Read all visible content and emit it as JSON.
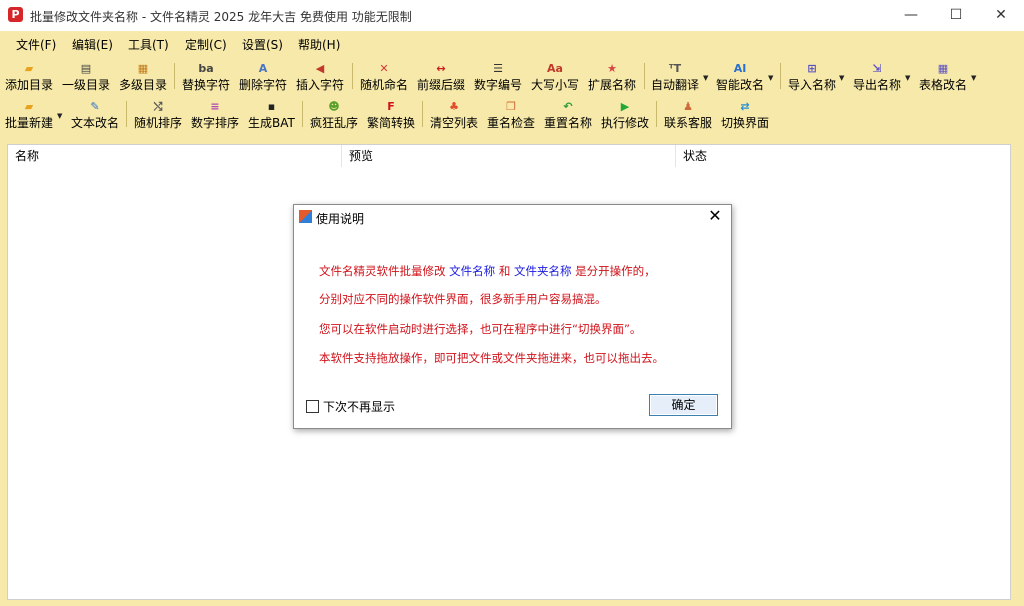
{
  "window": {
    "title": "批量修改文件夹名称 - 文件名精灵 2025 龙年大吉 免费使用 功能无限制",
    "app_icon": "P",
    "minimize_glyph": "—",
    "maximize_glyph": "☐",
    "close_glyph": "✕"
  },
  "menu": [
    "文件(F)",
    "编辑(E)",
    "工具(T)",
    "定制(C)",
    "设置(S)",
    "帮助(H)"
  ],
  "toolbar_row1": [
    {
      "label": "添加目录",
      "icon": "folder-add-icon",
      "glyph": "▰",
      "color": "#e8a21d"
    },
    {
      "label": "一级目录",
      "icon": "single-level-icon",
      "glyph": "▤",
      "color": "#444444"
    },
    {
      "label": "多级目录",
      "icon": "multi-level-icon",
      "glyph": "▦",
      "color": "#c07a1a"
    },
    {
      "label": "替换字符",
      "icon": "replace-text-icon",
      "glyph": "ba",
      "color": "#444444"
    },
    {
      "label": "删除字符",
      "icon": "delete-text-icon",
      "glyph": "A",
      "color": "#4673c6"
    },
    {
      "label": "插入字符",
      "icon": "insert-text-icon",
      "glyph": "◀",
      "color": "#c0392b"
    },
    {
      "label": "随机命名",
      "icon": "random-name-icon",
      "glyph": "✕",
      "color": "#d63b3b"
    },
    {
      "label": "前缀后缀",
      "icon": "prefix-suffix-icon",
      "glyph": "↔",
      "color": "#cc2020"
    },
    {
      "label": "数字编号",
      "icon": "number-list-icon",
      "glyph": "☰",
      "color": "#333333"
    },
    {
      "label": "大写小写",
      "icon": "case-icon",
      "glyph": "Aa",
      "color": "#c0392b"
    },
    {
      "label": "扩展名称",
      "icon": "extension-icon",
      "glyph": "★",
      "color": "#d64545"
    },
    {
      "label": "自动翻译",
      "icon": "translate-icon",
      "glyph": "ᵀT",
      "color": "#555555"
    },
    {
      "label": "智能改名",
      "icon": "ai-icon",
      "glyph": "AI",
      "color": "#2a6fd1"
    },
    {
      "label": "导入名称",
      "icon": "import-icon",
      "glyph": "⊞",
      "color": "#5b4fc4"
    },
    {
      "label": "导出名称",
      "icon": "export-icon",
      "glyph": "⇲",
      "color": "#5b4fc4"
    },
    {
      "label": "表格改名",
      "icon": "table-icon",
      "glyph": "▦",
      "color": "#5b4fc4"
    }
  ],
  "toolbar_row2": [
    {
      "label": "批量新建",
      "icon": "new-folder-icon",
      "glyph": "▰",
      "color": "#e8a21d"
    },
    {
      "label": "文本改名",
      "icon": "text-edit-icon",
      "glyph": "✎",
      "color": "#2a6fd1"
    },
    {
      "label": "随机排序",
      "icon": "shuffle-icon",
      "glyph": "⤭",
      "color": "#555555"
    },
    {
      "label": "数字排序",
      "icon": "sort-number-icon",
      "glyph": "≡",
      "color": "#b04ab0"
    },
    {
      "label": "生成BAT",
      "icon": "bat-icon",
      "glyph": "▪",
      "color": "#222222"
    },
    {
      "label": "疯狂乱序",
      "icon": "crazy-shuffle-icon",
      "glyph": "☻",
      "color": "#5aa02c"
    },
    {
      "label": "繁简转换",
      "icon": "convert-icon",
      "glyph": "F",
      "color": "#d0121a"
    },
    {
      "label": "清空列表",
      "icon": "clear-list-icon",
      "glyph": "♣",
      "color": "#e24a2a"
    },
    {
      "label": "重名检查",
      "icon": "duplicate-check-icon",
      "glyph": "❐",
      "color": "#d06a3a"
    },
    {
      "label": "重置名称",
      "icon": "reset-icon",
      "glyph": "↶",
      "color": "#2a9c3a"
    },
    {
      "label": "执行修改",
      "icon": "execute-icon",
      "glyph": "▶",
      "color": "#22a83a"
    },
    {
      "label": "联系客服",
      "icon": "support-icon",
      "glyph": "♟",
      "color": "#d06a3a"
    },
    {
      "label": "切换界面",
      "icon": "switch-ui-icon",
      "glyph": "⇄",
      "color": "#2a8fd1"
    }
  ],
  "table": {
    "columns": [
      "名称",
      "预览",
      "状态"
    ]
  },
  "dialog": {
    "title": "使用说明",
    "close_glyph": "✕",
    "line1_a": "文件名精灵软件批量修改",
    "line1_b": "文件名称",
    "line1_c": "和",
    "line1_d": "文件夹名称",
    "line1_e": "是分开操作的，",
    "line2": "分别对应不同的操作软件界面，很多新手用户容易搞混。",
    "line3": "您可以在软件启动时进行选择，也可在程序中进行“切换界面”。",
    "line4": "本软件支持拖放操作，即可把文件或文件夹拖进来，也可以拖出去。",
    "checkbox_label": "下次不再显示",
    "ok_label": "确定"
  }
}
